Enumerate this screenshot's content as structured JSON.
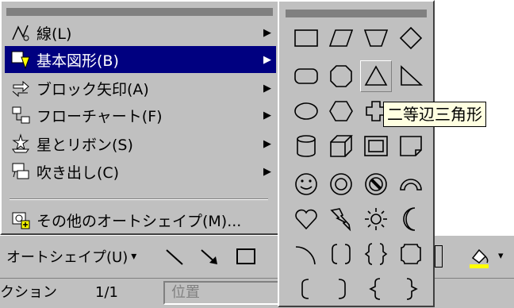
{
  "menu": {
    "items": [
      {
        "label": "線(L)",
        "icon": "line-icon"
      },
      {
        "label": "基本図形(B)",
        "icon": "basic-shapes-icon",
        "selected": true
      },
      {
        "label": "ブロック矢印(A)",
        "icon": "block-arrows-icon"
      },
      {
        "label": "フローチャート(F)",
        "icon": "flowchart-icon"
      },
      {
        "label": "星とリボン(S)",
        "icon": "stars-ribbons-icon"
      },
      {
        "label": "吹き出し(C)",
        "icon": "callouts-icon"
      },
      {
        "label": "その他のオートシェイプ(M)...",
        "icon": "more-autoshapes-icon"
      }
    ],
    "submenu_arrow": "▶"
  },
  "submenu": {
    "shapes": [
      "rectangle",
      "parallelogram",
      "trapezoid",
      "diamond",
      "rounded-rectangle",
      "octagon",
      "isosceles-triangle",
      "right-triangle",
      "oval",
      "hexagon",
      "cross",
      "",
      "can",
      "cube",
      "bevel",
      "folded-corner",
      "smiley-face",
      "donut",
      "no-symbol",
      "block-arc",
      "heart",
      "lightning-bolt",
      "sun",
      "moon",
      "arc",
      "double-bracket",
      "double-brace",
      "plaque",
      "left-bracket",
      "right-bracket",
      "left-brace",
      "right-brace"
    ],
    "hovered": "isosceles-triangle"
  },
  "tooltip": {
    "text": "二等辺三角形"
  },
  "toolbar": {
    "autoshape_label": "オートシェイプ(U)",
    "dropdown_arrow": "▾"
  },
  "statusbar": {
    "section": "クション",
    "page": "1/1",
    "position": "位置"
  }
}
